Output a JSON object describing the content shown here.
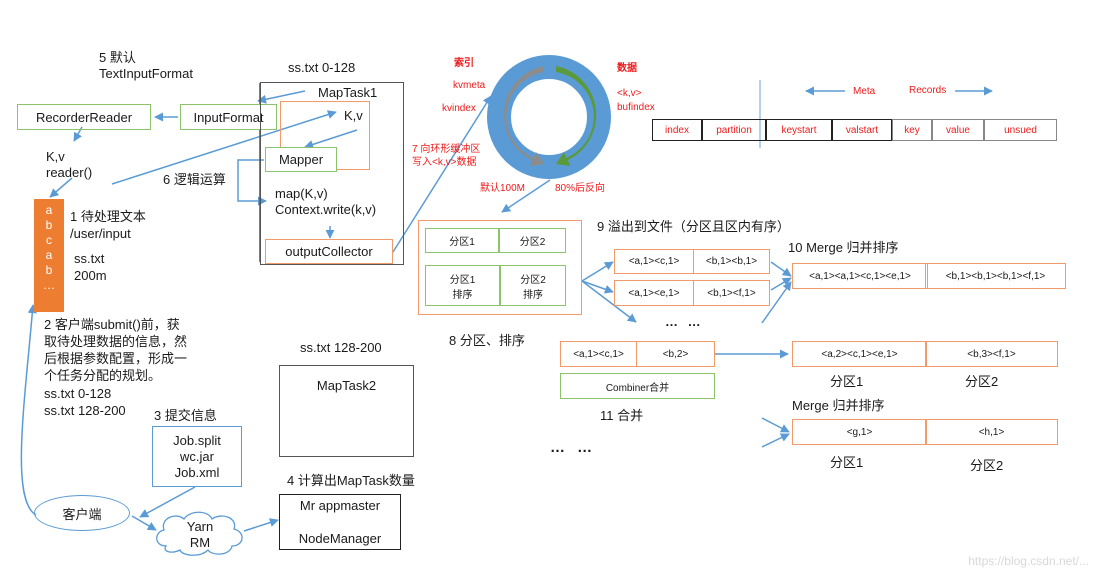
{
  "step5": {
    "label": "5 默认",
    "format": "TextInputFormat"
  },
  "recorder_reader": "RecorderReader",
  "input_format": "InputFormat",
  "kv_reader": {
    "kv": "K,v",
    "reader": "reader()"
  },
  "step6": "6 逻辑运算",
  "maptask1": {
    "split_label": "ss.txt 0-128",
    "title": "MapTask1",
    "kv": "K,v",
    "mapper": "Mapper",
    "map_call": "map(K,v)",
    "context_write": "Context.write(k,v)",
    "output_collector": "outputCollector"
  },
  "input_file": {
    "letters": [
      "a",
      "b",
      "c",
      "a",
      "b",
      "…"
    ],
    "step1": "1 待处理文本",
    "path": "/user/input",
    "name": "ss.txt",
    "size": "200m"
  },
  "step2": {
    "lines": [
      "2 客户端submit()前，获",
      "取待处理数据的信息，然",
      "后根据参数配置，形成一",
      "个任务分配的规划。"
    ],
    "splits": [
      "ss.txt  0-128",
      "ss.txt  128-200"
    ]
  },
  "step3": {
    "label": "3 提交信息",
    "files": [
      "Job.split",
      "wc.jar",
      "Job.xml"
    ]
  },
  "client": "客户端",
  "yarn": {
    "line1": "Yarn",
    "line2": "RM"
  },
  "step4": "4 计算出MapTask数量",
  "appmaster": {
    "line1": "Mr appmaster",
    "line2": "NodeManager"
  },
  "maptask2": {
    "split_label": "ss.txt 128-200",
    "title": "MapTask2"
  },
  "ring_buffer": {
    "index_label": "索引",
    "kvmeta": "kvmeta",
    "kvindex": "kvindex",
    "data_label": "数据",
    "kv": "<k,v>",
    "bufindex": "bufindex",
    "step7_line1": "7 向环形缓冲区",
    "step7_line2": "写入<k,v>数据",
    "default_size": "默认100M",
    "threshold": "80%后反向",
    "colors": {
      "ring": "#5b9bd5",
      "index_arrow": "#8c8c8c",
      "data_arrow": "#5a9a3a",
      "label": "#ee1c1c"
    }
  },
  "meta_table": {
    "meta_label": "Meta",
    "records_label": "Records",
    "cells": [
      "index",
      "partition",
      "keystart",
      "valstart",
      "key",
      "value",
      "unsued"
    ]
  },
  "step8": {
    "label": "8 分区、排序",
    "partitions": [
      "分区1",
      "分区2"
    ],
    "sorted": [
      [
        "分区1",
        "排序"
      ],
      [
        "分区2",
        "排序"
      ]
    ]
  },
  "step9": {
    "label": "9 溢出到文件（分区且区内有序）",
    "spill1": [
      "<a,1><c,1>",
      "<b,1><b,1>"
    ],
    "spill2": [
      "<a,1><e,1>",
      "<b,1><f,1>"
    ],
    "ellipsis": "… …"
  },
  "step10": {
    "label": "10 Merge 归并排序",
    "merged": [
      "<a,1><a,1><c,1><e,1>",
      "<b,1><b,1><b,1><f,1>"
    ]
  },
  "step11": {
    "combined": [
      "<a,1><c,1>",
      "<b,2>"
    ],
    "combiner": "Combiner合并",
    "label": "11 合并",
    "result": [
      "<a,2><c,1><e,1>",
      "<b,3><f,1>"
    ],
    "partition_labels": [
      "分区1",
      "分区2"
    ]
  },
  "merge2": {
    "label": "Merge 归并排序",
    "cells": [
      "<g,1>",
      "<h,1>"
    ],
    "partition_labels": [
      "分区1",
      "分区2"
    ]
  },
  "bottom_ellipsis": "… …",
  "watermark": "https://blog.csdn.net/..."
}
